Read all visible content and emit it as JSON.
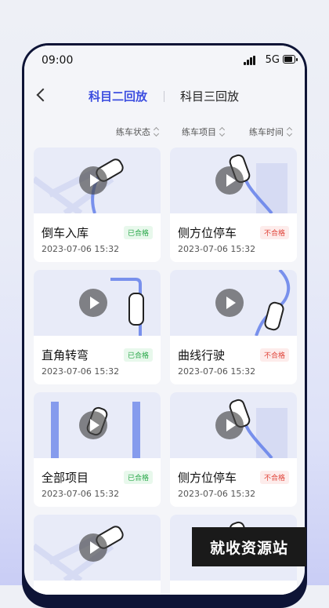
{
  "status": {
    "time": "09:00",
    "network": "5G"
  },
  "tabs": [
    {
      "label": "科目二回放"
    },
    {
      "label": "科目三回放"
    }
  ],
  "filters": [
    {
      "label": "练车状态"
    },
    {
      "label": "练车项目"
    },
    {
      "label": "练车时间"
    }
  ],
  "cards": [
    {
      "title": "倒车入库",
      "status": "已合格",
      "date": "2023-07-06 15:32"
    },
    {
      "title": "侧方位停车",
      "status": "不合格",
      "date": "2023-07-06 15:32"
    },
    {
      "title": "直角转弯",
      "status": "已合格",
      "date": "2023-07-06 15:32"
    },
    {
      "title": "曲线行驶",
      "status": "不合格",
      "date": "2023-07-06 15:32"
    },
    {
      "title": "全部项目",
      "status": "已合格",
      "date": "2023-07-06 15:32"
    },
    {
      "title": "侧方位停车",
      "status": "不合格",
      "date": "2023-07-06 15:32"
    },
    {
      "title": "",
      "status": "",
      "date": ""
    },
    {
      "title": "",
      "status": "",
      "date": ""
    }
  ],
  "watermark": "就收资源站",
  "colors": {
    "accent": "#3d4fe0",
    "pass": "#2aa84a",
    "fail": "#e0443a"
  }
}
